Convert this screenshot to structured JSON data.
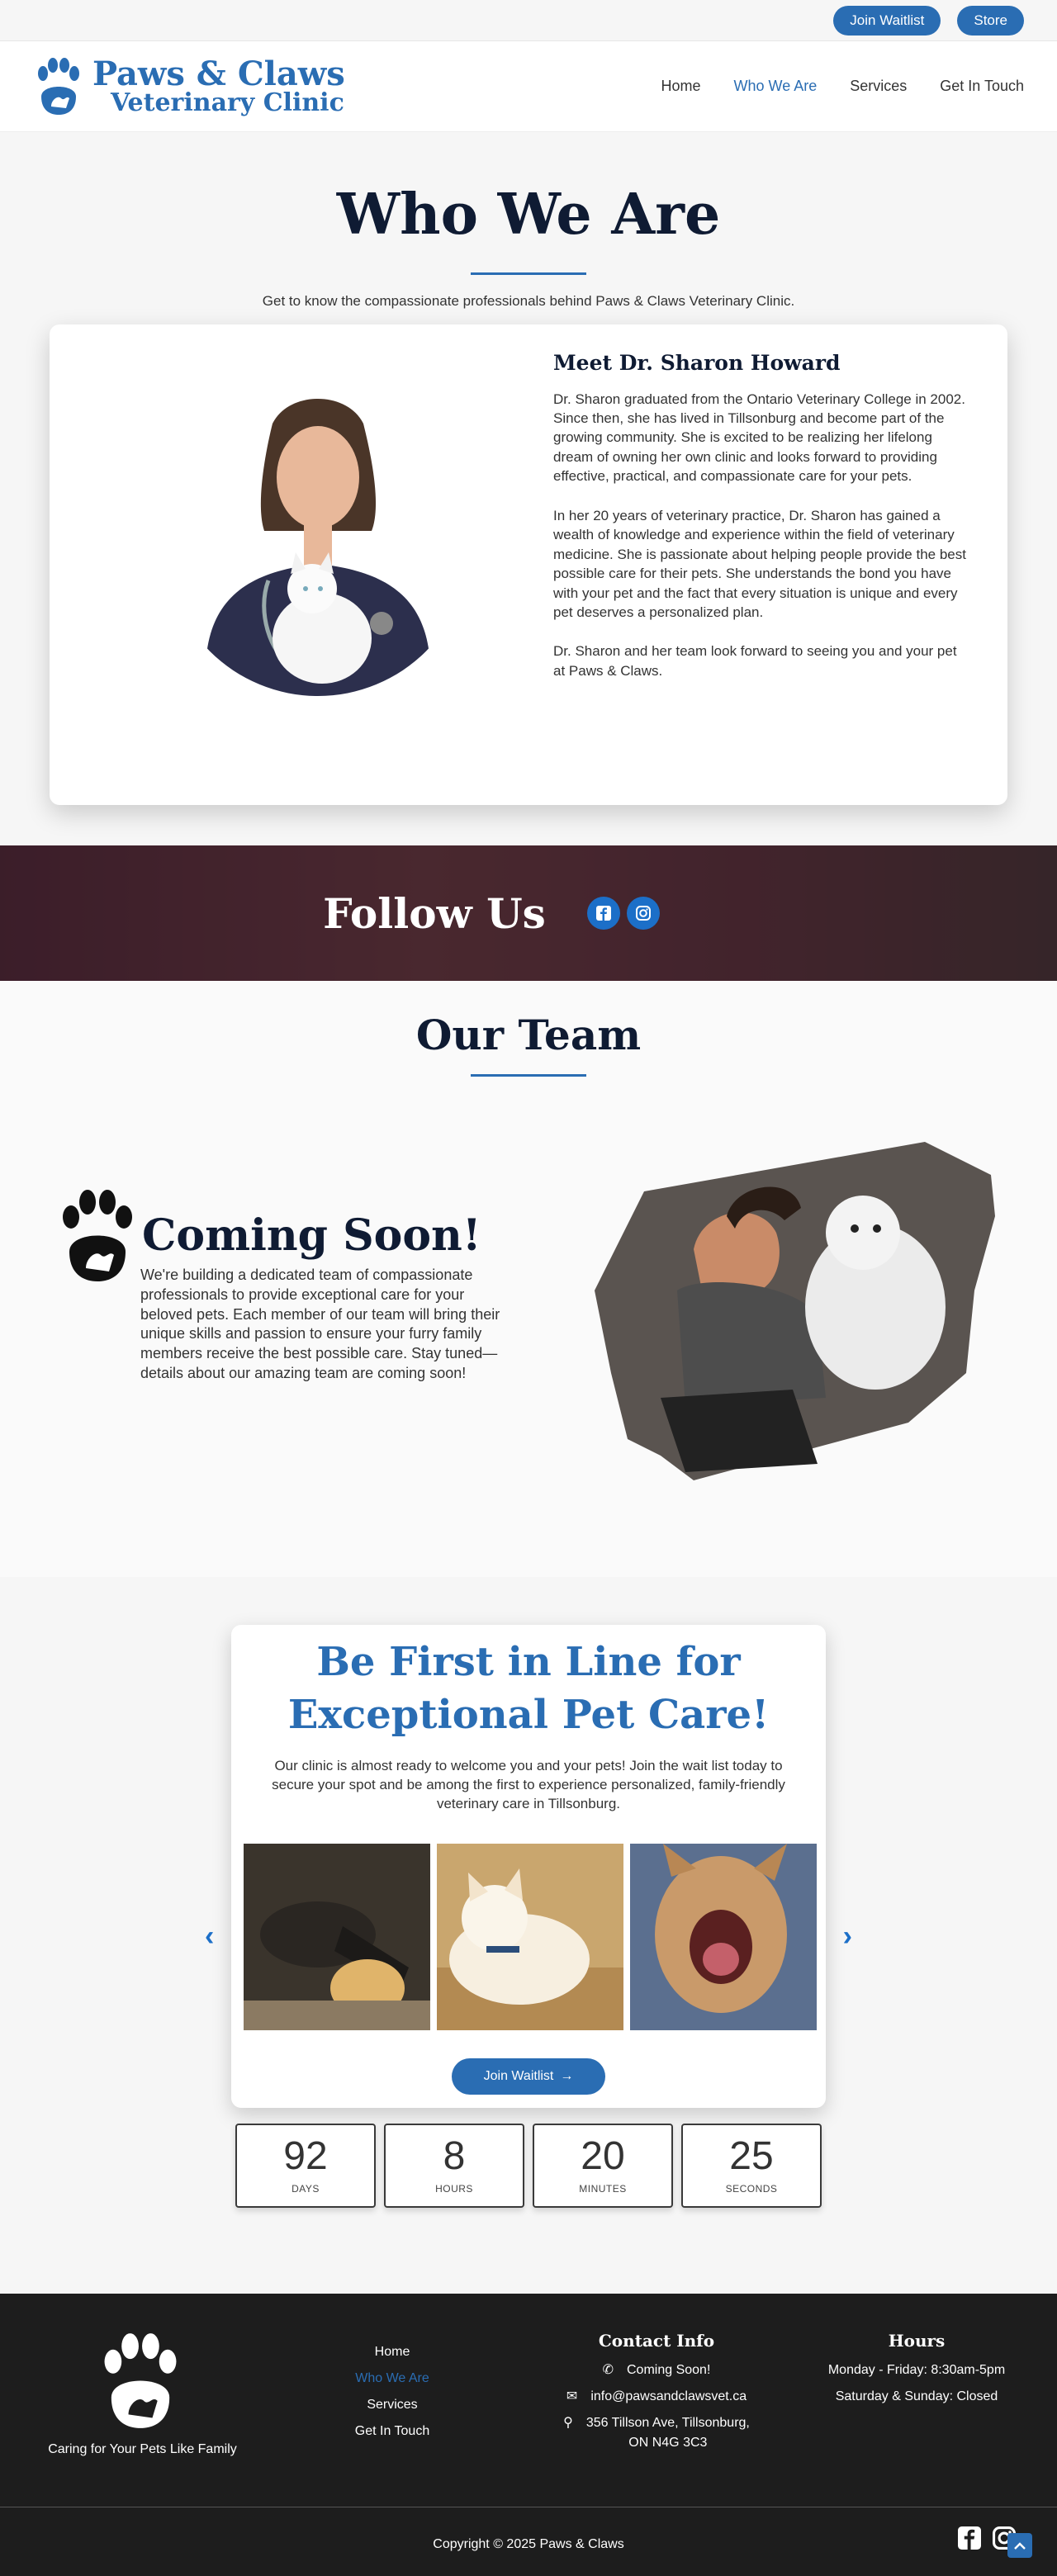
{
  "topbar": {
    "waitlist_label": "Join Waitlist",
    "store_label": "Store"
  },
  "logo": {
    "line1": "Paws & Claws",
    "line2": "Veterinary Clinic"
  },
  "nav": {
    "items": [
      "Home",
      "Who We Are",
      "Services",
      "Get In Touch"
    ],
    "active": "Who We Are"
  },
  "who": {
    "title": "Who We Are",
    "subtitle": "Get to know the compassionate professionals behind Paws & Claws Veterinary Clinic.",
    "heading": "Meet Dr. Sharon Howard",
    "p1": "Dr. Sharon graduated from the Ontario Veterinary College in 2002. Since then, she has lived in Tillsonburg and become part of the growing community. She is excited to be realizing her lifelong dream of owning her own clinic and looks forward to providing effective, practical, and compassionate care for your pets.",
    "p2": "In her 20 years of veterinary practice, Dr. Sharon has gained a wealth of knowledge and experience within the field of veterinary medicine. She is passionate about helping people provide the best possible care for their pets. She understands the bond you have with your pet and the fact that every situation is unique and every pet deserves a personalized plan.",
    "p3": "Dr. Sharon and her team look forward to seeing you and your pet at Paws & Claws."
  },
  "follow": {
    "title": "Follow Us"
  },
  "team": {
    "title": "Our Team",
    "soon_title": "Coming Soon!",
    "soon_text": "We're building a dedicated team of compassionate professionals to provide exceptional care for your beloved pets. Each member of our team will bring their unique skills and passion to ensure your furry family members receive the best possible care. Stay tuned—details about our amazing team are coming soon!"
  },
  "waitlist": {
    "title": "Be First in Line for Exceptional Pet Care!",
    "description": "Our clinic is almost ready to welcome you and your pets! Join the wait list today to secure your spot and be among the first to experience personalized, family-friendly veterinary care in Tillsonburg.",
    "button_label": "Join Waitlist"
  },
  "countdown": [
    {
      "value": "92",
      "label": "DAYS"
    },
    {
      "value": "8",
      "label": "HOURS"
    },
    {
      "value": "20",
      "label": "MINUTES"
    },
    {
      "value": "25",
      "label": "SECONDS"
    }
  ],
  "footer": {
    "tagline": "Caring for Your Pets Like Family",
    "links": [
      "Home",
      "Who We Are",
      "Services",
      "Get In Touch"
    ],
    "contact_title": "Contact Info",
    "phone": "Coming Soon!",
    "email": "info@pawsandclawsvet.ca",
    "address_line1": "356 Tillson Ave, Tillsonburg,",
    "address_line2": "ON N4G 3C3",
    "hours_title": "Hours",
    "hours_weekday": "Monday - Friday: 8:30am-5pm",
    "hours_weekend": "Saturday & Sunday: Closed",
    "copyright": "Copyright © 2025 Paws & Claws"
  },
  "colors": {
    "brand": "#2a6db3",
    "dark": "#0f1b33",
    "footer_bg": "#1d1d1d"
  }
}
